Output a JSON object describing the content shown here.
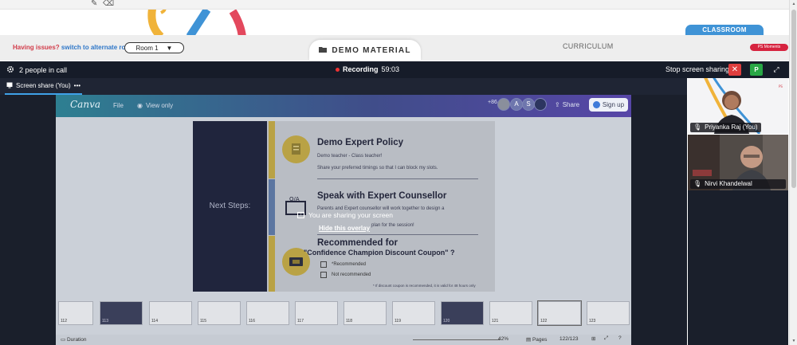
{
  "header": {
    "issues_text": "Having issues?",
    "alternate_link": "switch to alternate room",
    "room_value": "Room 1",
    "demo_tab": "DEMO MATERIAL",
    "curriculum_tab": "CURRICULUM",
    "classroom_tab": "CLASSROOM",
    "moments_badge": "PS Moments"
  },
  "call_bar": {
    "people_count": "2 people in call",
    "recording_label": "Recording",
    "recording_time": "59:03",
    "stop_sharing": "Stop screen sharing",
    "p_button": "P"
  },
  "share_tab": {
    "label": "Screen share (You)",
    "more": "•••"
  },
  "canva": {
    "logo": "Canva",
    "file": "File",
    "view_only": "View only",
    "collab_count": "+86",
    "avatar_a": "A",
    "avatar_s": "S",
    "share": "Share",
    "sign_up": "Sign up"
  },
  "slide": {
    "left_title": "Next Steps:",
    "section1_title": "Demo Expert Policy",
    "section1_line1": "Demo teacher - Class teacher!",
    "section1_line2": "Share your preferred timings so that I can block my slots.",
    "section2_title": "Speak with Expert Counsellor",
    "section2_line1": "Parents and Expert counsellor will work together to design a",
    "section2_line2": "plan for the session!",
    "section3_title": "Recommended for",
    "section3_subtitle": "\"Confidence Champion Discount Coupon\" ?",
    "option1": "*Recommended",
    "option2": "Not recommended",
    "footnote": "* If discount coupon is recommended, it is valid for 48 hours only"
  },
  "overlay": {
    "message": "You are sharing your screen",
    "hide": "Hide this overlay"
  },
  "thumbnails": [
    {
      "num": "112"
    },
    {
      "num": "113"
    },
    {
      "num": "114"
    },
    {
      "num": "115"
    },
    {
      "num": "116"
    },
    {
      "num": "117"
    },
    {
      "num": "118"
    },
    {
      "num": "119"
    },
    {
      "num": "120"
    },
    {
      "num": "121"
    },
    {
      "num": "122"
    },
    {
      "num": "123"
    }
  ],
  "bottom_bar": {
    "duration": "Duration",
    "zoom": "42%",
    "pages": "Pages",
    "page_count": "122/123"
  },
  "participants": [
    {
      "name": "Priyanka Raj (You)"
    },
    {
      "name": "Nirvi Khandelwal"
    }
  ],
  "colors": {
    "call_bar": "#161c29",
    "accent_blue": "#3f93d6",
    "record_red": "#e33333",
    "stop_red": "#df3e3e",
    "p_green": "#28a745"
  }
}
